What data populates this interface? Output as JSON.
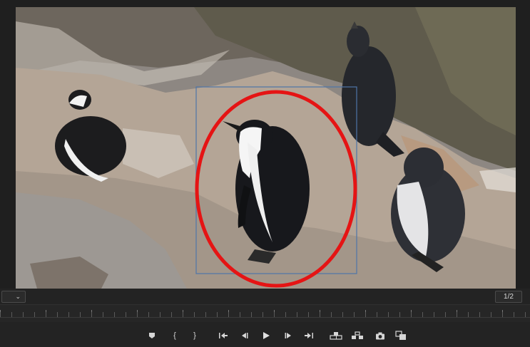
{
  "viewer": {
    "resolution_label": "1/2",
    "zoom_selected": ""
  },
  "colors": {
    "highlight_circle": "#e51414",
    "selection_box": "#4e74a8",
    "panel_bg": "#232323",
    "icon": "#d6d6d6"
  },
  "controls": {
    "add_marker": "marker-icon",
    "mark_in": "{",
    "mark_out": "}",
    "go_to_in": "go-to-in-icon",
    "step_back": "step-back-icon",
    "play": "play-icon",
    "step_forward": "step-forward-icon",
    "go_to_out": "go-to-out-icon",
    "lift": "lift-icon",
    "extract": "extract-icon",
    "export_frame": "camera-icon",
    "comparison_view": "comparison-view-icon"
  }
}
